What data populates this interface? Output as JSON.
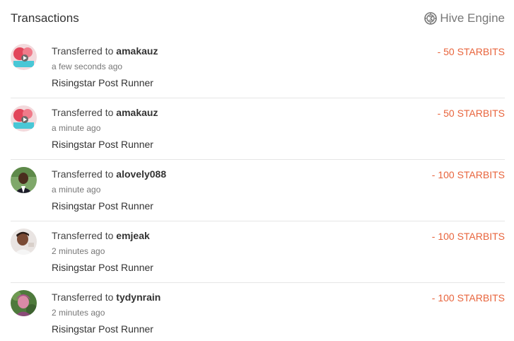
{
  "header": {
    "title": "Transactions",
    "engine_label": "Hive Engine",
    "engine_icon": "hive-engine-icon"
  },
  "transactions": [
    {
      "prefix": "Transferred to",
      "user": "amakauz",
      "time": "a few seconds ago",
      "memo": "Risingstar Post Runner",
      "amount": "- 50 STARBITS",
      "avatar": "avatar-amakauz"
    },
    {
      "prefix": "Transferred to",
      "user": "amakauz",
      "time": "a minute ago",
      "memo": "Risingstar Post Runner",
      "amount": "- 50 STARBITS",
      "avatar": "avatar-amakauz"
    },
    {
      "prefix": "Transferred to",
      "user": "alovely088",
      "time": "a minute ago",
      "memo": "Risingstar Post Runner",
      "amount": "- 100 STARBITS",
      "avatar": "avatar-alovely088"
    },
    {
      "prefix": "Transferred to",
      "user": "emjeak",
      "time": "2 minutes ago",
      "memo": "Risingstar Post Runner",
      "amount": "- 100 STARBITS",
      "avatar": "avatar-emjeak"
    },
    {
      "prefix": "Transferred to",
      "user": "tydynrain",
      "time": "2 minutes ago",
      "memo": "Risingstar Post Runner",
      "amount": "- 100 STARBITS",
      "avatar": "avatar-tydynrain"
    }
  ],
  "colors": {
    "amount": "#e8643c",
    "muted": "#777777",
    "text": "#333333",
    "divider": "#e6e6e6"
  }
}
